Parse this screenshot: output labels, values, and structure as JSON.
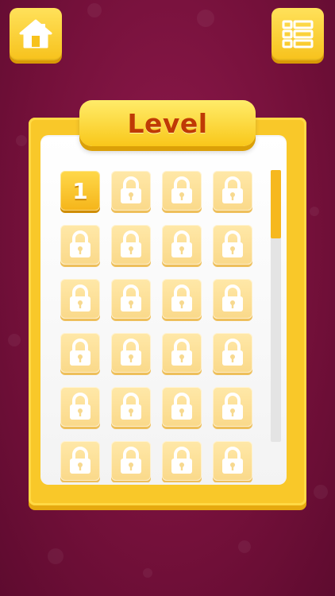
{
  "header": {
    "home_icon": "home-icon",
    "menu_icon": "level-list-icon"
  },
  "title": "Level",
  "levels": [
    {
      "label": "1",
      "locked": false
    },
    {
      "label": "",
      "locked": true
    },
    {
      "label": "",
      "locked": true
    },
    {
      "label": "",
      "locked": true
    },
    {
      "label": "",
      "locked": true
    },
    {
      "label": "",
      "locked": true
    },
    {
      "label": "",
      "locked": true
    },
    {
      "label": "",
      "locked": true
    },
    {
      "label": "",
      "locked": true
    },
    {
      "label": "",
      "locked": true
    },
    {
      "label": "",
      "locked": true
    },
    {
      "label": "",
      "locked": true
    },
    {
      "label": "",
      "locked": true
    },
    {
      "label": "",
      "locked": true
    },
    {
      "label": "",
      "locked": true
    },
    {
      "label": "",
      "locked": true
    },
    {
      "label": "",
      "locked": true
    },
    {
      "label": "",
      "locked": true
    },
    {
      "label": "",
      "locked": true
    },
    {
      "label": "",
      "locked": true
    },
    {
      "label": "",
      "locked": true
    },
    {
      "label": "",
      "locked": true
    },
    {
      "label": "",
      "locked": true
    },
    {
      "label": "",
      "locked": true
    }
  ],
  "scroll_position": 0.0,
  "colors": {
    "background": "#74103a",
    "accent": "#f9c829",
    "title_text": "#bf3a05"
  }
}
